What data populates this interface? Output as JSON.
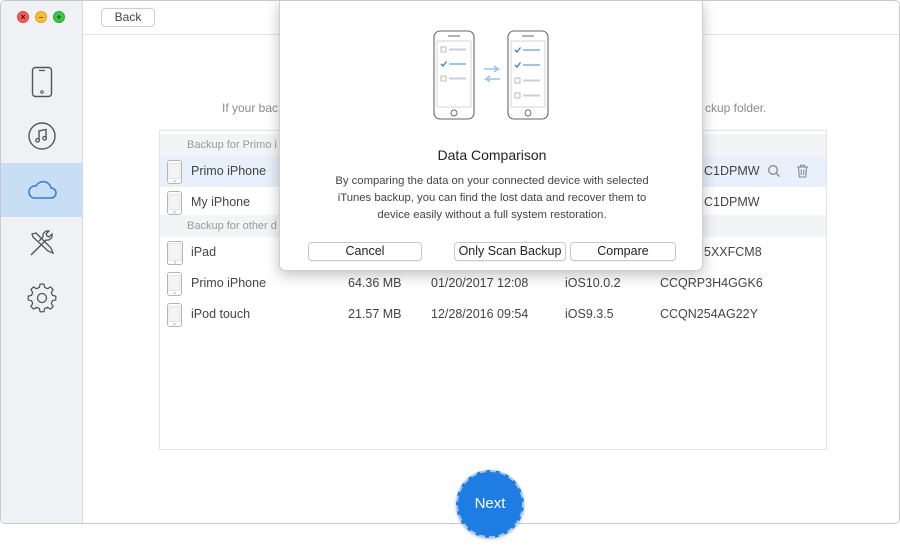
{
  "window": {
    "traffic_lights": {
      "close": "×",
      "minimize": "–",
      "maximize": "+"
    }
  },
  "sidebar": {
    "items": [
      {
        "id": "device",
        "icon": "phone-icon"
      },
      {
        "id": "itunes",
        "icon": "music-note-icon"
      },
      {
        "id": "icloud",
        "icon": "cloud-icon",
        "active": true
      },
      {
        "id": "tools",
        "icon": "tools-icon"
      },
      {
        "id": "settings",
        "icon": "gear-icon"
      }
    ]
  },
  "header": {
    "back_label": "Back"
  },
  "main": {
    "subtitle_left": "If your bac",
    "subtitle_right": "ckup folder.",
    "groups": [
      {
        "label": "Backup for Primo i"
      },
      {
        "label": "Backup for other d"
      }
    ],
    "rows": [
      {
        "name": "Primo iPhone",
        "size": "",
        "date": "",
        "ios": "",
        "serial": "C1DPMW",
        "selected": true
      },
      {
        "name": "My iPhone",
        "size": "",
        "date": "",
        "ios": "",
        "serial": "C1DPMW"
      },
      {
        "name": "iPad",
        "size": "",
        "date": "",
        "ios": "",
        "serial": "5XXFCM8"
      },
      {
        "name": "Primo iPhone",
        "size": "64.36 MB",
        "date": "01/20/2017 12:08",
        "ios": "iOS10.0.2",
        "serial": "CCQRP3H4GGK6"
      },
      {
        "name": "iPod touch",
        "size": "21.57 MB",
        "date": "12/28/2016 09:54",
        "ios": "iOS9.3.5",
        "serial": "CCQN254AG22Y"
      }
    ],
    "next_label": "Next"
  },
  "modal": {
    "title": "Data Comparison",
    "description": "By comparing the data on your connected device with selected iTunes backup, you can find the lost data and recover them to device easily without a full system restoration.",
    "cancel_label": "Cancel",
    "scan_label": "Only Scan Backup",
    "compare_label": "Compare"
  },
  "colors": {
    "accent": "#1e7de3",
    "sidebar_active": "#c8def5",
    "selected_row": "#e7f0fb"
  }
}
